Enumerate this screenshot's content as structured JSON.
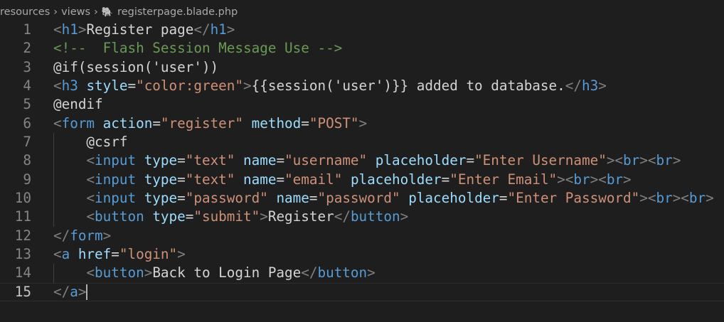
{
  "breadcrumb": {
    "items": [
      "resources",
      "views"
    ],
    "file": "registerpage.blade.php",
    "file_icon": "php-elephant-icon"
  },
  "colors": {
    "background": "#1e1e1e",
    "bracket": "#808080",
    "tag": "#569cd6",
    "attribute": "#9cdcfe",
    "string": "#ce9178",
    "comment": "#6a9955",
    "text": "#d4d4d4"
  },
  "active_line": 15,
  "lines": [
    {
      "n": "1",
      "guide": false,
      "tokens": [
        [
          "br",
          "<"
        ],
        [
          "tag",
          "h1"
        ],
        [
          "br",
          ">"
        ],
        [
          "txt",
          "Register page"
        ],
        [
          "br",
          "</"
        ],
        [
          "tag",
          "h1"
        ],
        [
          "br",
          ">"
        ]
      ]
    },
    {
      "n": "2",
      "guide": false,
      "tokens": [
        [
          "com",
          "<!--  Flash Session Message Use -->"
        ]
      ]
    },
    {
      "n": "3",
      "guide": false,
      "tokens": [
        [
          "txt",
          "@if(session('user'))"
        ]
      ]
    },
    {
      "n": "4",
      "guide": false,
      "tokens": [
        [
          "br",
          "<"
        ],
        [
          "tag",
          "h3"
        ],
        [
          "txt",
          " "
        ],
        [
          "attr",
          "style"
        ],
        [
          "txt",
          "="
        ],
        [
          "str",
          "\"color:green\""
        ],
        [
          "br",
          ">"
        ],
        [
          "txt",
          "{{session('user')}} added to database."
        ],
        [
          "br",
          "</"
        ],
        [
          "tag",
          "h3"
        ],
        [
          "br",
          ">"
        ]
      ]
    },
    {
      "n": "5",
      "guide": false,
      "tokens": [
        [
          "txt",
          "@endif"
        ]
      ]
    },
    {
      "n": "6",
      "guide": false,
      "tokens": [
        [
          "br",
          "<"
        ],
        [
          "tag",
          "form"
        ],
        [
          "txt",
          " "
        ],
        [
          "attr",
          "action"
        ],
        [
          "txt",
          "="
        ],
        [
          "str",
          "\"register\""
        ],
        [
          "txt",
          " "
        ],
        [
          "attr",
          "method"
        ],
        [
          "txt",
          "="
        ],
        [
          "str",
          "\"POST\""
        ],
        [
          "br",
          ">"
        ]
      ]
    },
    {
      "n": "7",
      "guide": true,
      "tokens": [
        [
          "txt",
          "    @csrf"
        ]
      ]
    },
    {
      "n": "8",
      "guide": true,
      "tokens": [
        [
          "txt",
          "    "
        ],
        [
          "br",
          "<"
        ],
        [
          "tag",
          "input"
        ],
        [
          "txt",
          " "
        ],
        [
          "attr",
          "type"
        ],
        [
          "txt",
          "="
        ],
        [
          "str",
          "\"text\""
        ],
        [
          "txt",
          " "
        ],
        [
          "attr",
          "name"
        ],
        [
          "txt",
          "="
        ],
        [
          "str",
          "\"username\""
        ],
        [
          "txt",
          " "
        ],
        [
          "attr",
          "placeholder"
        ],
        [
          "txt",
          "="
        ],
        [
          "str",
          "\"Enter Username\""
        ],
        [
          "br",
          "><"
        ],
        [
          "tag",
          "br"
        ],
        [
          "br",
          "><"
        ],
        [
          "tag",
          "br"
        ],
        [
          "br",
          ">"
        ]
      ]
    },
    {
      "n": "9",
      "guide": true,
      "tokens": [
        [
          "txt",
          "    "
        ],
        [
          "br",
          "<"
        ],
        [
          "tag",
          "input"
        ],
        [
          "txt",
          " "
        ],
        [
          "attr",
          "type"
        ],
        [
          "txt",
          "="
        ],
        [
          "str",
          "\"text\""
        ],
        [
          "txt",
          " "
        ],
        [
          "attr",
          "name"
        ],
        [
          "txt",
          "="
        ],
        [
          "str",
          "\"email\""
        ],
        [
          "txt",
          " "
        ],
        [
          "attr",
          "placeholder"
        ],
        [
          "txt",
          "="
        ],
        [
          "str",
          "\"Enter Email\""
        ],
        [
          "br",
          "><"
        ],
        [
          "tag",
          "br"
        ],
        [
          "br",
          "><"
        ],
        [
          "tag",
          "br"
        ],
        [
          "br",
          ">"
        ]
      ]
    },
    {
      "n": "10",
      "guide": true,
      "tokens": [
        [
          "txt",
          "    "
        ],
        [
          "br",
          "<"
        ],
        [
          "tag",
          "input"
        ],
        [
          "txt",
          " "
        ],
        [
          "attr",
          "type"
        ],
        [
          "txt",
          "="
        ],
        [
          "str",
          "\"password\""
        ],
        [
          "txt",
          " "
        ],
        [
          "attr",
          "name"
        ],
        [
          "txt",
          "="
        ],
        [
          "str",
          "\"password\""
        ],
        [
          "txt",
          " "
        ],
        [
          "attr",
          "placeholder"
        ],
        [
          "txt",
          "="
        ],
        [
          "str",
          "\"Enter Password\""
        ],
        [
          "br",
          "><"
        ],
        [
          "tag",
          "br"
        ],
        [
          "br",
          "><"
        ],
        [
          "tag",
          "br"
        ],
        [
          "br",
          ">"
        ]
      ]
    },
    {
      "n": "11",
      "guide": true,
      "tokens": [
        [
          "txt",
          "    "
        ],
        [
          "br",
          "<"
        ],
        [
          "tag",
          "button"
        ],
        [
          "txt",
          " "
        ],
        [
          "attr",
          "type"
        ],
        [
          "txt",
          "="
        ],
        [
          "str",
          "\"submit\""
        ],
        [
          "br",
          ">"
        ],
        [
          "txt",
          "Register"
        ],
        [
          "br",
          "</"
        ],
        [
          "tag",
          "button"
        ],
        [
          "br",
          ">"
        ]
      ]
    },
    {
      "n": "12",
      "guide": false,
      "tokens": [
        [
          "br",
          "</"
        ],
        [
          "tag",
          "form"
        ],
        [
          "br",
          ">"
        ]
      ]
    },
    {
      "n": "13",
      "guide": false,
      "tokens": [
        [
          "br",
          "<"
        ],
        [
          "tag",
          "a"
        ],
        [
          "txt",
          " "
        ],
        [
          "attr",
          "href"
        ],
        [
          "txt",
          "="
        ],
        [
          "str",
          "\"login\""
        ],
        [
          "br",
          ">"
        ]
      ]
    },
    {
      "n": "14",
      "guide": true,
      "tokens": [
        [
          "txt",
          "    "
        ],
        [
          "br",
          "<"
        ],
        [
          "tag",
          "button"
        ],
        [
          "br",
          ">"
        ],
        [
          "txt",
          "Back to Login Page"
        ],
        [
          "br",
          "</"
        ],
        [
          "tag",
          "button"
        ],
        [
          "br",
          ">"
        ]
      ]
    },
    {
      "n": "15",
      "guide": false,
      "tokens": [
        [
          "br",
          "</"
        ],
        [
          "tag",
          "a"
        ],
        [
          "br",
          ">"
        ]
      ]
    }
  ]
}
